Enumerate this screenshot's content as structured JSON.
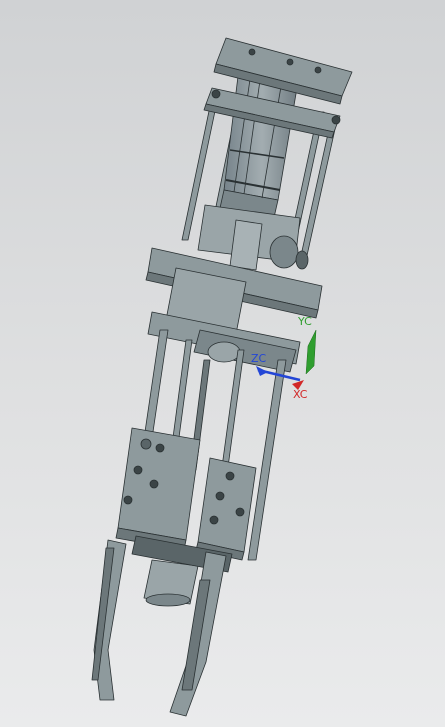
{
  "viewport": {
    "background_top": "#d0d2d4",
    "background_bottom": "#eaebec"
  },
  "model": {
    "fill": "#8e9a9d",
    "edge": "#2a3133",
    "shade": "#6c777a",
    "dark": "#3b4446"
  },
  "triad": {
    "yc": {
      "label": "YC",
      "color": "#2f9e2f"
    },
    "zc": {
      "label": "ZC",
      "color": "#2346d6"
    },
    "xc": {
      "label": "XC",
      "color": "#d22828"
    }
  }
}
